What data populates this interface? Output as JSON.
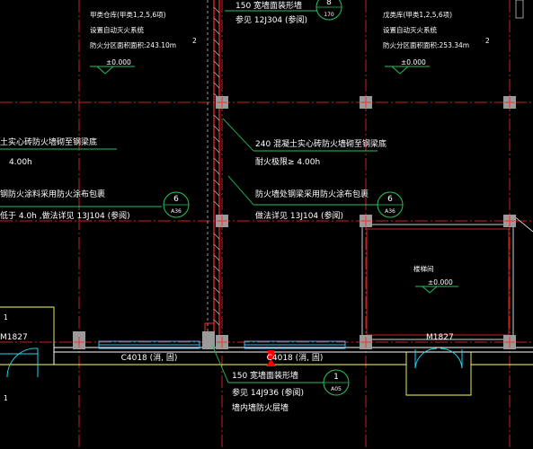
{
  "drawing": {
    "colors": {
      "background": "#000000",
      "axis": "#cc1f1f",
      "wall": "#ff2a2a",
      "column_fill": "#9a9a9a",
      "leader": "#22c55e",
      "window": "#38bdf8",
      "door": "#22d3ee",
      "hatch": "#cfcfcf",
      "boundary": "#ffff66",
      "marker": "#ff0000",
      "text": "#ffffff"
    },
    "top_left_note": {
      "line1": "甲类仓库(甲类1,2,5,6项)",
      "line2": "设置自动灭火系统",
      "line3": "防火分区面积面积:243.10m",
      "index": "2",
      "elevation": "±0.000"
    },
    "top_right_note": {
      "line1": "戊类库(甲类1,2,5,6项)",
      "line2": "设置自动灭火系统",
      "line3": "防火分区面积面积:253.34m",
      "index": "2",
      "elevation": "±0.000"
    },
    "top_center": {
      "line1": "150  宽墙面装形墙",
      "line2": "参见 12J304 (参阅)",
      "bubble_number": "8",
      "bubble_sheet": "170"
    },
    "left_notes": {
      "line1": "土实心砖防火墙砌至钢梁底",
      "line2": "4.00h",
      "line3": "钢防火涂料采用防火涂布包裹",
      "line4": "低于   4.0h ,做法详见   13J104  (参阅)",
      "bubble_number": "6",
      "bubble_sheet": "A36"
    },
    "center_notes": {
      "line1": "240 混凝土实心砖防火墙砌至钢梁底",
      "line2": "耐火极限≥   4.00h",
      "line3": "防火墙处钢梁采用防火涂布包裹",
      "line4": "做法详见   13J104   (参阅)",
      "bubble_number": "6",
      "bubble_sheet": "A36"
    },
    "right_room": {
      "name": "楼梯间",
      "elevation": "±0.000"
    },
    "door_right": "M1827",
    "door_left": "M1827",
    "window_left": "C4018 (消, 固)",
    "window_center": "C4018 (消, 固)",
    "bottom_note": {
      "line1": "150  宽墙面装形墙",
      "line2": "参见 14J936 (参阅)",
      "line3": "墙内墙防火层墙",
      "bubble_number": "1",
      "bubble_sheet": "A05"
    },
    "far_left_label": "1"
  }
}
